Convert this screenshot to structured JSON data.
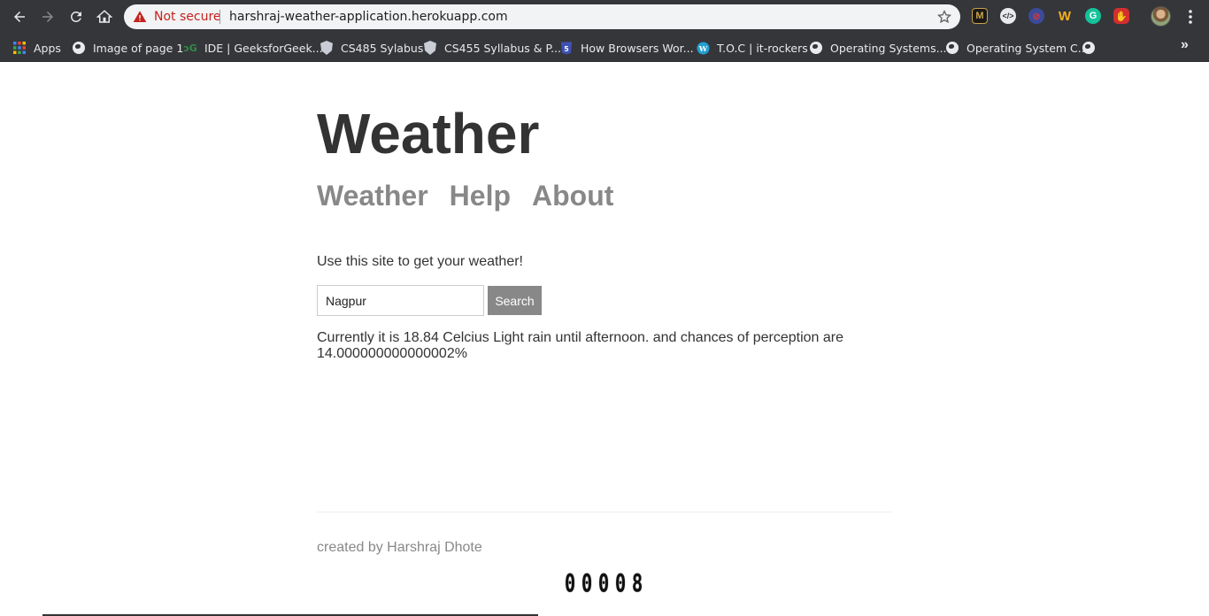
{
  "browser": {
    "security_label": "Not secure",
    "url": "harshraj-weather-application.herokuapp.com",
    "bookmarks": [
      {
        "label": "Apps",
        "icon": "apps-grid-icon"
      },
      {
        "label": "Image of page 1",
        "icon": "globe-icon"
      },
      {
        "label": "IDE | GeeksforGeek...",
        "icon": "geeksforgeeks-icon"
      },
      {
        "label": "CS485 Sylabus",
        "icon": "shield-icon"
      },
      {
        "label": "CS455 Syllabus & P...",
        "icon": "shield-icon"
      },
      {
        "label": "How Browsers Wor...",
        "icon": "html5-icon"
      },
      {
        "label": "T.O.C | it-rockers",
        "icon": "wordpress-icon"
      },
      {
        "label": "Operating Systems...",
        "icon": "globe-icon"
      },
      {
        "label": "Operating System C...",
        "icon": "globe-icon"
      },
      {
        "label": "",
        "icon": "globe-icon"
      }
    ],
    "more_bookmarks": "»"
  },
  "page": {
    "title": "Weather",
    "nav": [
      {
        "label": "Weather"
      },
      {
        "label": "Help"
      },
      {
        "label": "About"
      }
    ],
    "intro": "Use this site to get your weather!",
    "search": {
      "value": "Nagpur",
      "button_label": "Search"
    },
    "result": "Currently it is 18.84 Celcius Light rain until afternoon. and chances of perception are 14.000000000000002%",
    "footer": "created by Harshraj Dhote",
    "counter": [
      "0",
      "0",
      "0",
      "0",
      "8"
    ]
  },
  "colors": {
    "chrome_bg": "#35363a",
    "omnibox_bg": "#f1f3f4",
    "warning_red": "#c5221f",
    "heading": "#333333",
    "nav_link": "#888888",
    "button_bg": "#888888"
  }
}
